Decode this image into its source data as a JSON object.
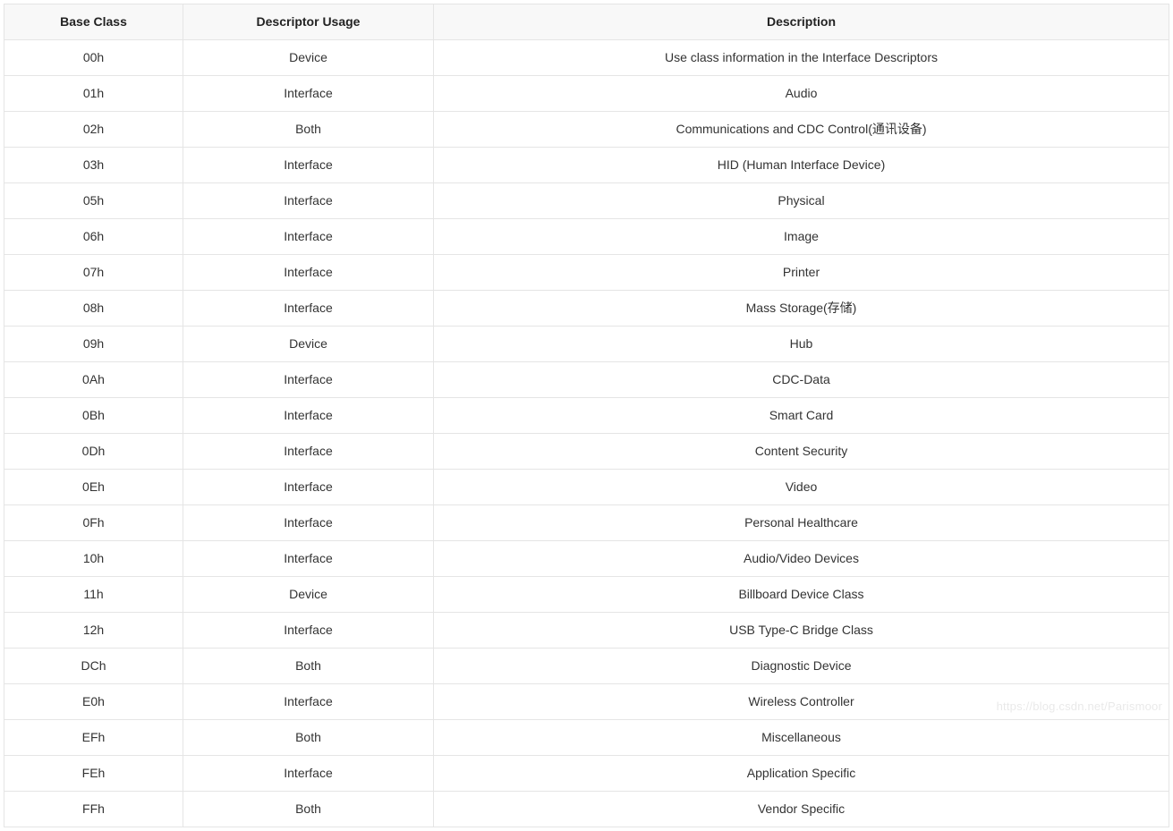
{
  "table": {
    "headers": [
      "Base Class",
      "Descriptor Usage",
      "Description"
    ],
    "rows": [
      {
        "base": "00h",
        "usage": "Device",
        "desc": "Use class information in the Interface Descriptors"
      },
      {
        "base": "01h",
        "usage": "Interface",
        "desc": "Audio"
      },
      {
        "base": "02h",
        "usage": "Both",
        "desc": "Communications and CDC Control(通讯设备)"
      },
      {
        "base": "03h",
        "usage": "Interface",
        "desc": "HID (Human Interface Device)"
      },
      {
        "base": "05h",
        "usage": "Interface",
        "desc": "Physical"
      },
      {
        "base": "06h",
        "usage": "Interface",
        "desc": "Image"
      },
      {
        "base": "07h",
        "usage": "Interface",
        "desc": "Printer"
      },
      {
        "base": "08h",
        "usage": "Interface",
        "desc": "Mass Storage(存储)"
      },
      {
        "base": "09h",
        "usage": "Device",
        "desc": "Hub"
      },
      {
        "base": "0Ah",
        "usage": "Interface",
        "desc": "CDC-Data"
      },
      {
        "base": "0Bh",
        "usage": "Interface",
        "desc": "Smart Card"
      },
      {
        "base": "0Dh",
        "usage": "Interface",
        "desc": "Content Security"
      },
      {
        "base": "0Eh",
        "usage": "Interface",
        "desc": "Video"
      },
      {
        "base": "0Fh",
        "usage": "Interface",
        "desc": "Personal Healthcare"
      },
      {
        "base": "10h",
        "usage": "Interface",
        "desc": "Audio/Video Devices"
      },
      {
        "base": "11h",
        "usage": "Device",
        "desc": "Billboard Device Class"
      },
      {
        "base": "12h",
        "usage": "Interface",
        "desc": "USB Type-C Bridge Class"
      },
      {
        "base": "DCh",
        "usage": "Both",
        "desc": "Diagnostic Device"
      },
      {
        "base": "E0h",
        "usage": "Interface",
        "desc": "Wireless Controller"
      },
      {
        "base": "EFh",
        "usage": "Both",
        "desc": "Miscellaneous"
      },
      {
        "base": "FEh",
        "usage": "Interface",
        "desc": "Application Specific"
      },
      {
        "base": "FFh",
        "usage": "Both",
        "desc": "Vendor Specific"
      }
    ]
  },
  "watermark": "https://blog.csdn.net/Parismoor"
}
